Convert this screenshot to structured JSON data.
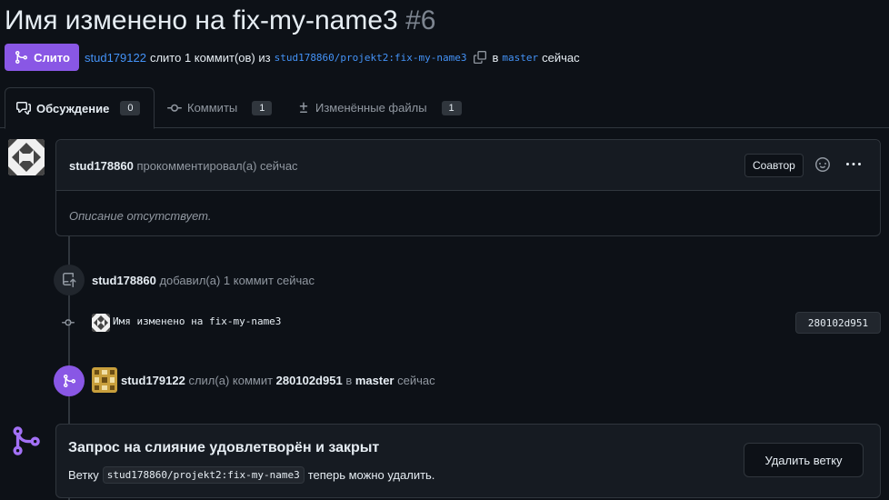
{
  "header": {
    "title": "Имя изменено на fix-my-name3",
    "number": "#6",
    "state_label": "Слито",
    "merger": "stud179122",
    "merged_text": "слито 1 коммит(ов) из",
    "head_branch": "stud178860/projekt2:fix-my-name3",
    "into_text": "в",
    "base_branch": "master",
    "time": "сейчас"
  },
  "tabs": [
    {
      "label": "Обсуждение",
      "count": "0",
      "icon": "comment-discussion-icon"
    },
    {
      "label": "Коммиты",
      "count": "1",
      "icon": "git-commit-icon"
    },
    {
      "label": "Изменённые файлы",
      "count": "1",
      "icon": "diff-icon"
    }
  ],
  "comment": {
    "author": "stud178860",
    "action": "прокомментировал(а) сейчас",
    "badge": "Соавтор",
    "body": "Описание отсутствует."
  },
  "events": {
    "push": {
      "author": "stud178860",
      "action": "добавил(а) 1 коммит сейчас"
    },
    "commit": {
      "message": "Имя изменено на fix-my-name3",
      "sha": "280102d951"
    },
    "merge": {
      "author": "stud179122",
      "action_prefix": "слил(а) коммит",
      "sha": "280102d951",
      "into": "в",
      "branch": "master",
      "time": "сейчас"
    }
  },
  "merged_box": {
    "title": "Запрос на слияние удовлетворён и закрыт",
    "desc_prefix": "Ветку",
    "branch": "stud178860/projekt2:fix-my-name3",
    "desc_suffix": "теперь можно удалить.",
    "delete_button": "Удалить ветку"
  },
  "colors": {
    "background": "#0d1117",
    "merged_purple": "#8957e5",
    "link_blue": "#4493f8",
    "border": "#30363d"
  }
}
